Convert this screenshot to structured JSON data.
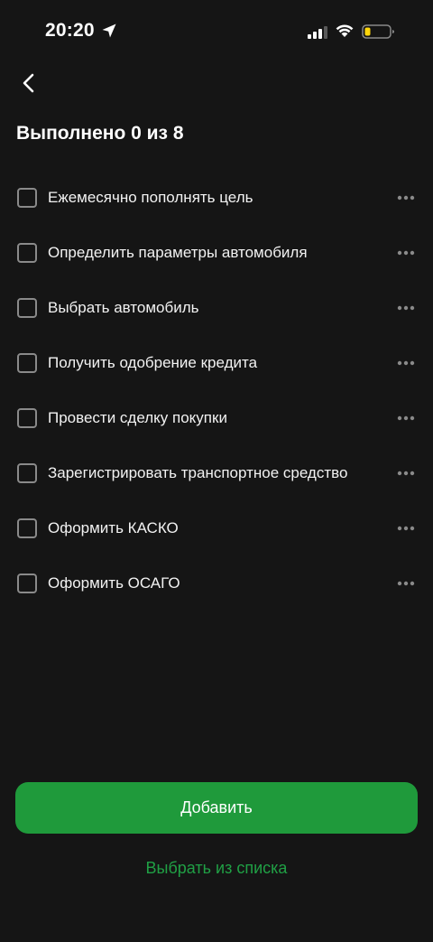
{
  "status_bar": {
    "time": "20:20",
    "icons": [
      "location-arrow-icon",
      "signal-icon",
      "wifi-icon",
      "battery-icon"
    ],
    "battery_color": "#ffd60a"
  },
  "header": {
    "back_icon": "chevron-left-icon",
    "title": "Выполнено 0 из 8"
  },
  "tasks": [
    {
      "label": "Ежемесячно пополнять цель",
      "checked": false
    },
    {
      "label": "Определить параметры автомобиля",
      "checked": false
    },
    {
      "label": "Выбрать автомобиль",
      "checked": false
    },
    {
      "label": "Получить одобрение кредита",
      "checked": false
    },
    {
      "label": "Провести сделку покупки",
      "checked": false
    },
    {
      "label": "Зарегистрировать транспортное средство",
      "checked": false
    },
    {
      "label": "Оформить КАСКО",
      "checked": false
    },
    {
      "label": "Оформить ОСАГО",
      "checked": false
    }
  ],
  "actions": {
    "add_label": "Добавить",
    "choose_label": "Выбрать из списка"
  },
  "colors": {
    "background": "#151515",
    "accent": "#1f9a3b",
    "link": "#20a045"
  }
}
